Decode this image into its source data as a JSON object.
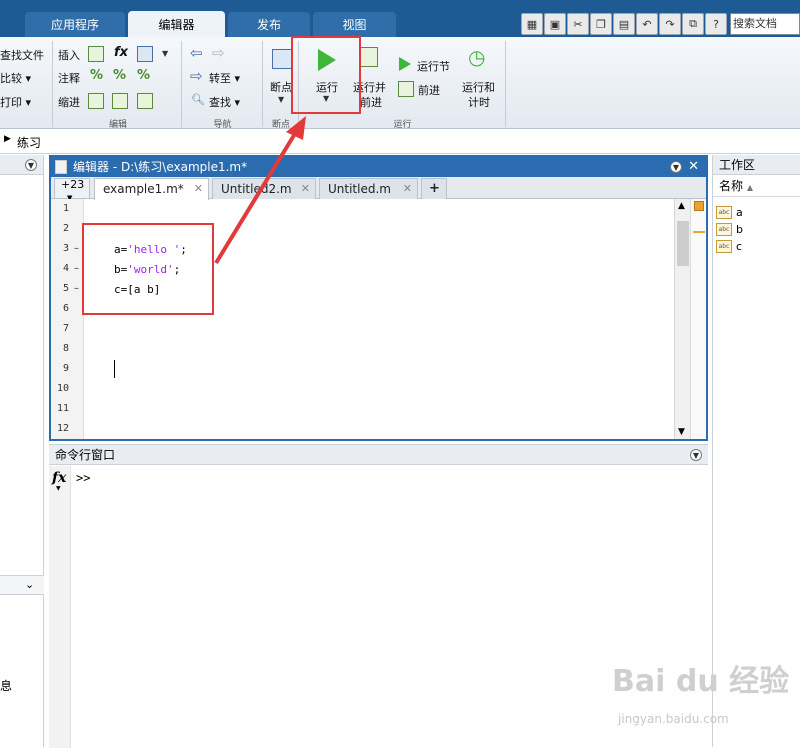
{
  "tabs": {
    "apps": "应用程序",
    "editor": "编辑器",
    "publish": "发布",
    "view": "视图"
  },
  "quick_access": {
    "search_placeholder": "搜索文档"
  },
  "ribbon": {
    "file_group": {
      "find_files": "查找文件",
      "compare": "比较",
      "print": "打印"
    },
    "edit_group": {
      "insert": "插入",
      "comment": "注释",
      "indent": "缩进",
      "fx": "fx",
      "label": "编辑"
    },
    "navigate_group": {
      "goto": "转至",
      "find": "查找",
      "label": "导航"
    },
    "breakpoints_group": {
      "breakpoints": "断点",
      "label": "断点"
    },
    "run_group": {
      "run": "运行",
      "run_advance_line1": "运行并",
      "run_advance_line2": "前进",
      "run_section": "运行节",
      "advance": "前进",
      "run_time_line1": "运行和",
      "run_time_line2": "计时",
      "label": "运行"
    }
  },
  "breadcrumb": {
    "folder": "练习"
  },
  "editor": {
    "title": "编辑器 - D:\\练习\\example1.m*",
    "nav_count": "+23",
    "tabs": [
      {
        "label": "example1.m*"
      },
      {
        "label": "Untitled2.m"
      },
      {
        "label": "Untitled.m"
      }
    ],
    "add_tab": "+",
    "line_numbers": [
      "1",
      "2",
      "3",
      "4",
      "5",
      "6",
      "7",
      "8",
      "9",
      "10",
      "11",
      "12"
    ],
    "code": {
      "line3_var": "a=",
      "line3_str": "'hello '",
      "line3_end": ";",
      "line4_var": "b=",
      "line4_str": "'world'",
      "line4_end": ";",
      "line5": "c=[a b]"
    }
  },
  "command_window": {
    "title": "命令行窗口",
    "fx": "fx",
    "prompt": ">>"
  },
  "workspace": {
    "title": "工作区",
    "column_header": "名称",
    "variables": [
      {
        "icon": "abc",
        "name": "a"
      },
      {
        "icon": "abc",
        "name": "b"
      },
      {
        "icon": "abc",
        "name": "c"
      }
    ]
  },
  "left_panel": {
    "detail_fragment": "息"
  },
  "watermark": {
    "brand": "Bai du 经验",
    "url": "jingyan.baidu.com"
  },
  "colors": {
    "accent": "#1e5b95",
    "annotation": "#e03a3a",
    "run_green": "#3fb53a",
    "string": "#a020f0"
  }
}
